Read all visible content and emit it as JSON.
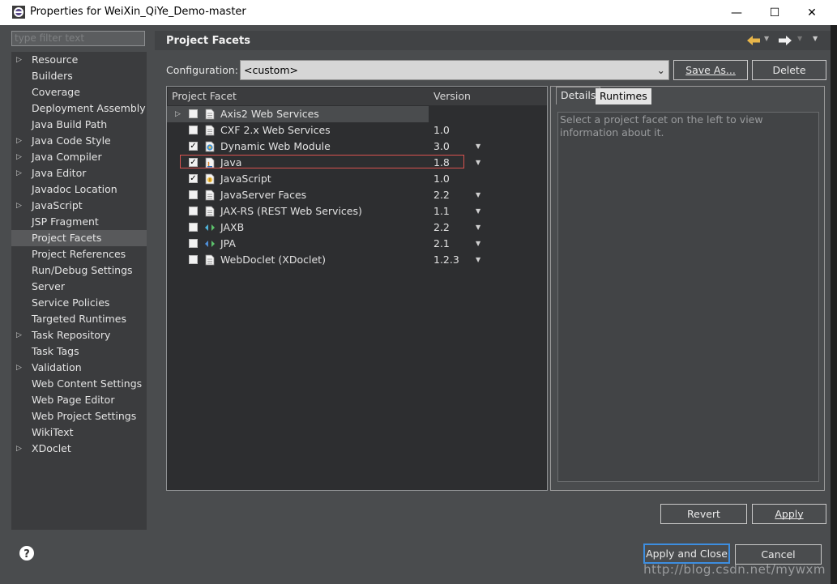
{
  "window": {
    "title": "Properties for WeiXin_QiYe_Demo-master",
    "minimize": "—",
    "maximize": "☐",
    "close": "✕"
  },
  "sidebar": {
    "filter_placeholder": "type filter text",
    "items": [
      {
        "label": "Resource",
        "expandable": true
      },
      {
        "label": "Builders",
        "expandable": false
      },
      {
        "label": "Coverage",
        "expandable": false
      },
      {
        "label": "Deployment Assembly",
        "expandable": false
      },
      {
        "label": "Java Build Path",
        "expandable": false
      },
      {
        "label": "Java Code Style",
        "expandable": true
      },
      {
        "label": "Java Compiler",
        "expandable": true
      },
      {
        "label": "Java Editor",
        "expandable": true
      },
      {
        "label": "Javadoc Location",
        "expandable": false
      },
      {
        "label": "JavaScript",
        "expandable": true
      },
      {
        "label": "JSP Fragment",
        "expandable": false
      },
      {
        "label": "Project Facets",
        "expandable": false,
        "selected": true
      },
      {
        "label": "Project References",
        "expandable": false
      },
      {
        "label": "Run/Debug Settings",
        "expandable": false
      },
      {
        "label": "Server",
        "expandable": false
      },
      {
        "label": "Service Policies",
        "expandable": false
      },
      {
        "label": "Targeted Runtimes",
        "expandable": false
      },
      {
        "label": "Task Repository",
        "expandable": true
      },
      {
        "label": "Task Tags",
        "expandable": false
      },
      {
        "label": "Validation",
        "expandable": true
      },
      {
        "label": "Web Content Settings",
        "expandable": false
      },
      {
        "label": "Web Page Editor",
        "expandable": false
      },
      {
        "label": "Web Project Settings",
        "expandable": false
      },
      {
        "label": "WikiText",
        "expandable": false
      },
      {
        "label": "XDoclet",
        "expandable": true
      }
    ]
  },
  "page": {
    "title": "Project Facets"
  },
  "config": {
    "label": "Configuration:",
    "value": "<custom>",
    "save_as": "Save As...",
    "delete": "Delete"
  },
  "facets": {
    "col_facet": "Project Facet",
    "col_version": "Version",
    "rows": [
      {
        "name": "Axis2 Web Services",
        "version": "",
        "checked": false,
        "expandable": true,
        "dropdown": false,
        "icon": "doc-icon"
      },
      {
        "name": "CXF 2.x Web Services",
        "version": "1.0",
        "checked": false,
        "expandable": false,
        "dropdown": false,
        "icon": "doc-icon"
      },
      {
        "name": "Dynamic Web Module",
        "version": "3.0",
        "checked": true,
        "expandable": false,
        "dropdown": true,
        "icon": "web-module-icon"
      },
      {
        "name": "Java",
        "version": "1.8",
        "checked": true,
        "expandable": false,
        "dropdown": true,
        "icon": "java-icon",
        "highlighted": true
      },
      {
        "name": "JavaScript",
        "version": "1.0",
        "checked": true,
        "expandable": false,
        "dropdown": false,
        "icon": "javascript-icon"
      },
      {
        "name": "JavaServer Faces",
        "version": "2.2",
        "checked": false,
        "expandable": false,
        "dropdown": true,
        "icon": "doc-icon"
      },
      {
        "name": "JAX-RS (REST Web Services)",
        "version": "1.1",
        "checked": false,
        "expandable": false,
        "dropdown": true,
        "icon": "doc-icon"
      },
      {
        "name": "JAXB",
        "version": "2.2",
        "checked": false,
        "expandable": false,
        "dropdown": true,
        "icon": "jaxb-icon"
      },
      {
        "name": "JPA",
        "version": "2.1",
        "checked": false,
        "expandable": false,
        "dropdown": true,
        "icon": "jpa-icon"
      },
      {
        "name": "WebDoclet (XDoclet)",
        "version": "1.2.3",
        "checked": false,
        "expandable": false,
        "dropdown": true,
        "icon": "doc-icon"
      }
    ]
  },
  "details": {
    "tab_details": "Details",
    "tab_runtimes": "Runtimes",
    "text": "Select a project facet on the left to view information about it."
  },
  "buttons": {
    "revert": "Revert",
    "apply": "Apply",
    "apply_close": "Apply and Close",
    "cancel": "Cancel"
  },
  "watermark": "http://blog.csdn.net/mywxm",
  "colors": {
    "dialog_bg": "#4a4c4e",
    "table_bg": "#2d2e30",
    "highlight_border": "#d9534f",
    "apply_close_border": "#3d8ee0"
  }
}
